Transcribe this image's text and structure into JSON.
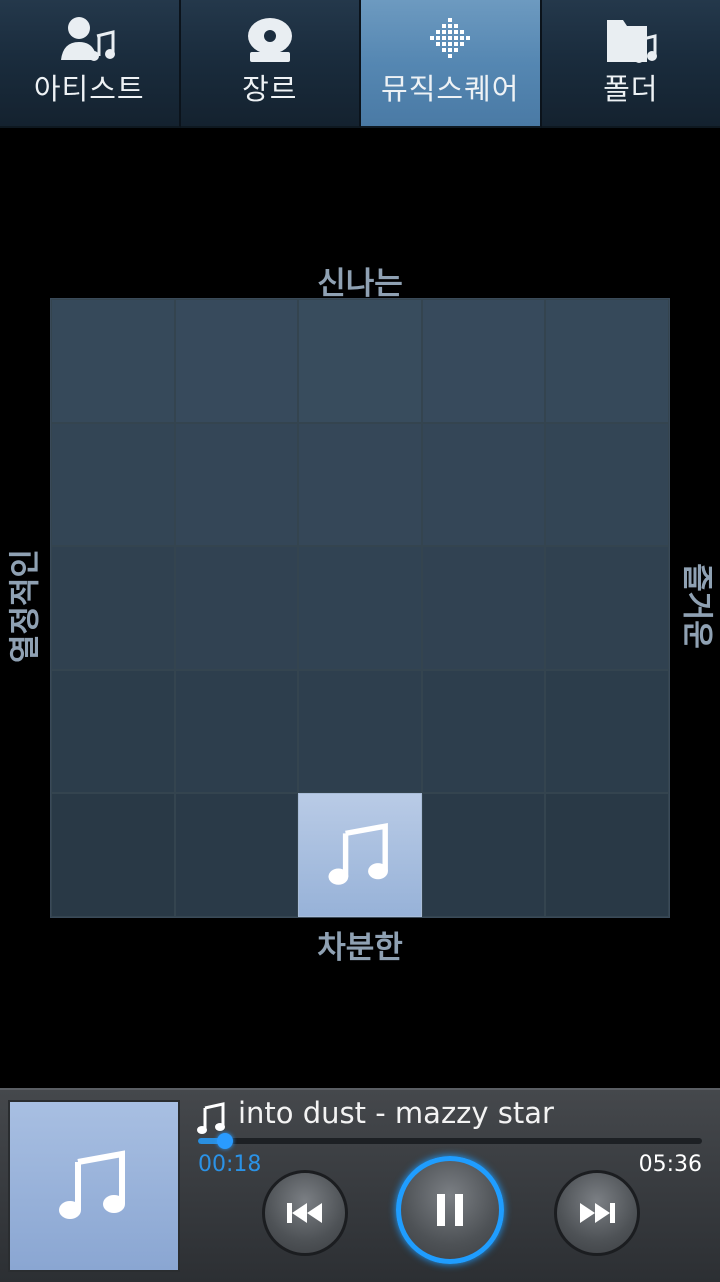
{
  "tabs": [
    {
      "label": "아티스트",
      "icon": "artist-icon",
      "active": false
    },
    {
      "label": "장르",
      "icon": "genre-icon",
      "active": false
    },
    {
      "label": "뮤직스퀘어",
      "icon": "music-square-icon",
      "active": true
    },
    {
      "label": "폴더",
      "icon": "folder-icon",
      "active": false
    }
  ],
  "music_square": {
    "top_label": "신나는",
    "bottom_label": "차분한",
    "left_label": "열정적인",
    "right_label": "즐거운",
    "active_cell": {
      "row": 5,
      "col": 3
    }
  },
  "player": {
    "track": "into dust - mazzy star",
    "elapsed": "00:18",
    "duration": "05:36",
    "progress_fraction": 0.054,
    "accent_color": "#1f9dff"
  }
}
